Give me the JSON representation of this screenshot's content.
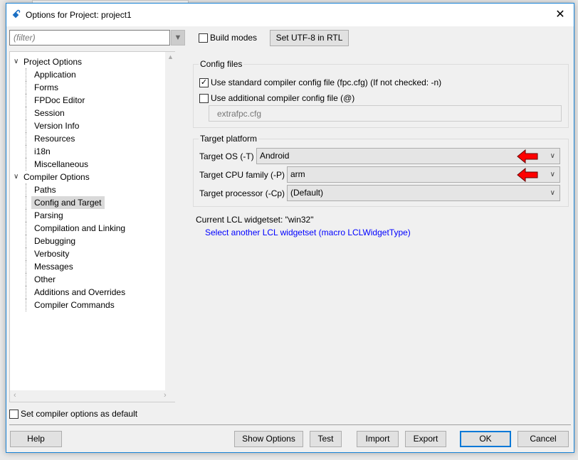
{
  "window": {
    "title": "Options for Project: project1",
    "close": "✕",
    "bg_tab": "unit1"
  },
  "filter": {
    "placeholder": "(filter)"
  },
  "tree": [
    {
      "label": "Project Options",
      "level": 0,
      "expanded": true
    },
    {
      "label": "Application",
      "level": 1
    },
    {
      "label": "Forms",
      "level": 1
    },
    {
      "label": "FPDoc Editor",
      "level": 1
    },
    {
      "label": "Session",
      "level": 1
    },
    {
      "label": "Version Info",
      "level": 1
    },
    {
      "label": "Resources",
      "level": 1
    },
    {
      "label": "i18n",
      "level": 1
    },
    {
      "label": "Miscellaneous",
      "level": 1
    },
    {
      "label": "Compiler Options",
      "level": 0,
      "expanded": true
    },
    {
      "label": "Paths",
      "level": 1
    },
    {
      "label": "Config and Target",
      "level": 1,
      "selected": true
    },
    {
      "label": "Parsing",
      "level": 1
    },
    {
      "label": "Compilation and Linking",
      "level": 1
    },
    {
      "label": "Debugging",
      "level": 1
    },
    {
      "label": "Verbosity",
      "level": 1
    },
    {
      "label": "Messages",
      "level": 1
    },
    {
      "label": "Other",
      "level": 1
    },
    {
      "label": "Additions and Overrides",
      "level": 1
    },
    {
      "label": "Compiler Commands",
      "level": 1
    }
  ],
  "top": {
    "build_modes": "Build modes",
    "build_modes_checked": false,
    "utf8_button": "Set UTF-8 in RTL"
  },
  "config_files": {
    "title": "Config files",
    "standard": "Use standard compiler config file (fpc.cfg) (If not checked: -n)",
    "standard_checked": true,
    "additional": "Use additional compiler config file (@)",
    "additional_checked": false,
    "additional_value": "extrafpc.cfg"
  },
  "target": {
    "title": "Target platform",
    "os_label": "Target OS (-T)",
    "os_value": "Android",
    "cpu_label": "Target CPU family (-P)",
    "cpu_value": "arm",
    "proc_label": "Target processor (-Cp)",
    "proc_value": "(Default)",
    "arrow_color": "#ff0000"
  },
  "lcl": {
    "current": "Current LCL widgetset: \"win32\"",
    "link": "Select another LCL widgetset (macro LCLWidgetType)",
    "link_color": "#0000ff"
  },
  "default_cb": {
    "label": "Set compiler options as default",
    "checked": false
  },
  "buttons": {
    "help": "Help",
    "show_options": "Show Options",
    "test": "Test",
    "import": "Import",
    "export": "Export",
    "ok": "OK",
    "cancel": "Cancel"
  }
}
